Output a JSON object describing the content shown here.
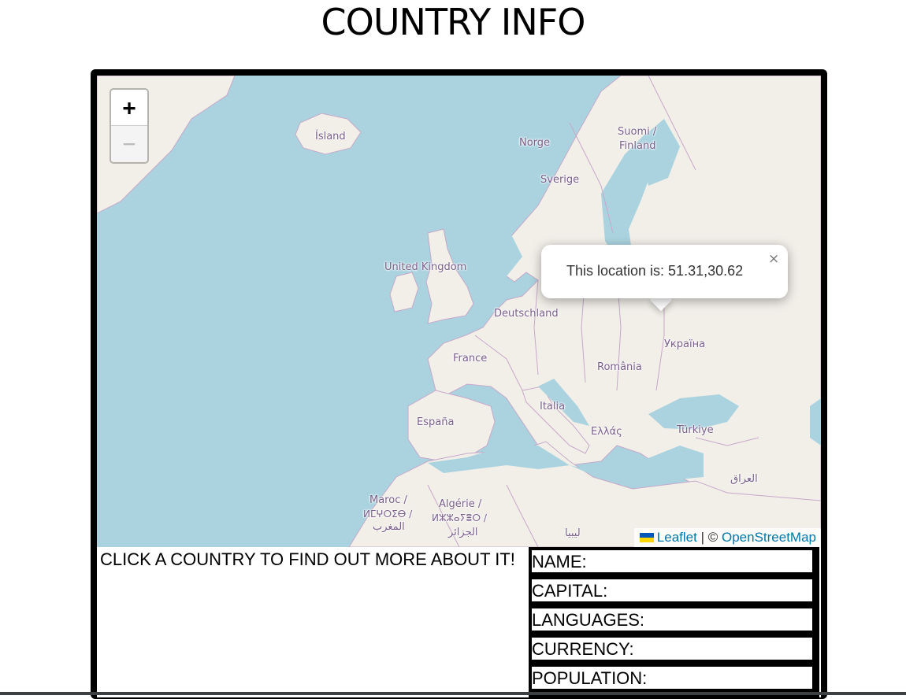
{
  "page": {
    "title": "COUNTRY INFO"
  },
  "map": {
    "zoom_in_label": "+",
    "zoom_out_label": "−",
    "labels": {
      "iceland": "Ísland",
      "norway": "Norge",
      "finland_line1": "Suomi /",
      "finland_line2": "Finland",
      "sweden": "Sverige",
      "uk": "United Kingdom",
      "germany": "Deutschland",
      "ukraine": "Україна",
      "france": "France",
      "romania": "România",
      "italy": "Italia",
      "spain": "España",
      "greece": "Ελλάς",
      "turkey": "Türkiye",
      "iraq": "العراق",
      "morocco_line1": "Maroc /",
      "morocco_line2": "ⵍⵎⵖⵔⵉⴱ /",
      "morocco_line3": "المغرب",
      "algeria_line1": "Algérie /",
      "algeria_line2": "ⵍⵣⵣⴰⵢⴻⵔ /",
      "algeria_line3": "الجزائر",
      "libya": "ليبيا"
    },
    "popup": {
      "text": "This location is: 51.31,30.62",
      "close_label": "×"
    },
    "attribution": {
      "leaflet_label": "Leaflet",
      "separator": "| ©",
      "osm_label": "OpenStreetMap"
    }
  },
  "info": {
    "prompt": "CLICK A COUNTRY TO FIND OUT MORE ABOUT IT!",
    "fields": {
      "name": "NAME:",
      "capital": "CAPITAL:",
      "languages": "LANGUAGES:",
      "currency": "CURRENCY:",
      "population": "POPULATION:"
    }
  },
  "colors": {
    "water": "#aad3df",
    "land": "#f2efe9",
    "border": "#c6a9c9",
    "link": "#0078a8",
    "flag_blue": "#0057b7",
    "flag_yellow": "#ffd700"
  }
}
